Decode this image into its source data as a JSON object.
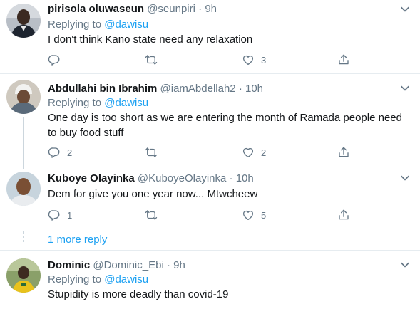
{
  "tweets": [
    {
      "name": "pirisola oluwaseun",
      "handle": "@seunpiri",
      "time": "9h",
      "replying_prefix": "Replying to",
      "replying_to": "@dawisu",
      "text": "I don't think Kano state need any relaxation",
      "replies": "",
      "retweets": "",
      "likes": "3"
    },
    {
      "name": "Abdullahi bin Ibrahim",
      "handle": "@iamAbdellah2",
      "time": "10h",
      "replying_prefix": "Replying to",
      "replying_to": "@dawisu",
      "text": "One day is too short as we are entering the month of Ramada people need to buy food stuff",
      "replies": "2",
      "retweets": "",
      "likes": "2"
    },
    {
      "name": "Kuboye Olayinka",
      "handle": "@KuboyeOlayinka",
      "time": "10h",
      "text": "Dem for give you one year now... Mtwcheew",
      "replies": "1",
      "retweets": "",
      "likes": "5"
    },
    {
      "name": "Dominic",
      "handle": "@Dominic_Ebi",
      "time": "9h",
      "replying_prefix": "Replying to",
      "replying_to": "@dawisu",
      "text": "Stupidity is more deadly than covid-19"
    }
  ],
  "separator": "·",
  "more_replies": "1 more reply",
  "icons": {
    "reply": "reply-icon",
    "retweet": "retweet-icon",
    "like": "heart-icon",
    "share": "share-icon",
    "menu": "chevron-down-icon"
  },
  "colors": {
    "accent": "#1da1f2",
    "muted": "#657786",
    "text": "#14171a",
    "divider": "#e6ecf0"
  }
}
